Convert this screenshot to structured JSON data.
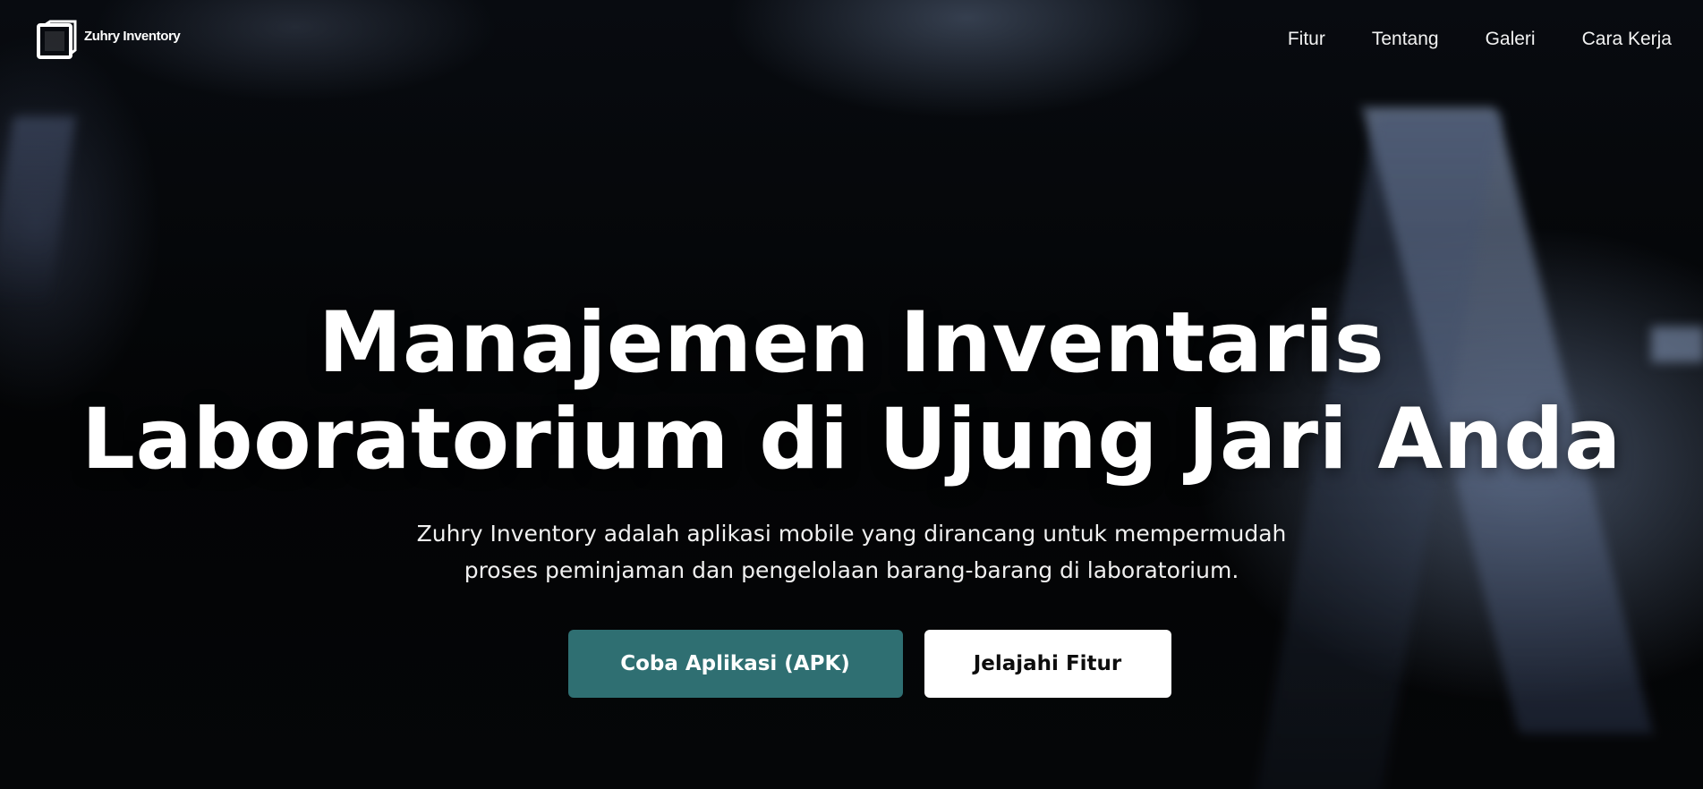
{
  "brand": {
    "name": "Zuhry Inventory",
    "icon": "box-logo-icon"
  },
  "nav": {
    "items": [
      {
        "label": "Fitur"
      },
      {
        "label": "Tentang"
      },
      {
        "label": "Galeri"
      },
      {
        "label": "Cara Kerja"
      }
    ]
  },
  "hero": {
    "title_line1": "Manajemen Inventaris",
    "title_line2": "Laboratorium di Ujung Jari Anda",
    "subtitle_line1": "Zuhry Inventory adalah aplikasi mobile yang dirancang untuk mempermudah",
    "subtitle_line2": "proses peminjaman dan pengelolaan barang-barang di laboratorium.",
    "primary_cta": "Coba Aplikasi (APK)",
    "secondary_cta": "Jelajahi Fitur"
  },
  "colors": {
    "primary_button": "#2f6f72",
    "secondary_button": "#ffffff",
    "text": "#ffffff",
    "background": "#000000"
  }
}
